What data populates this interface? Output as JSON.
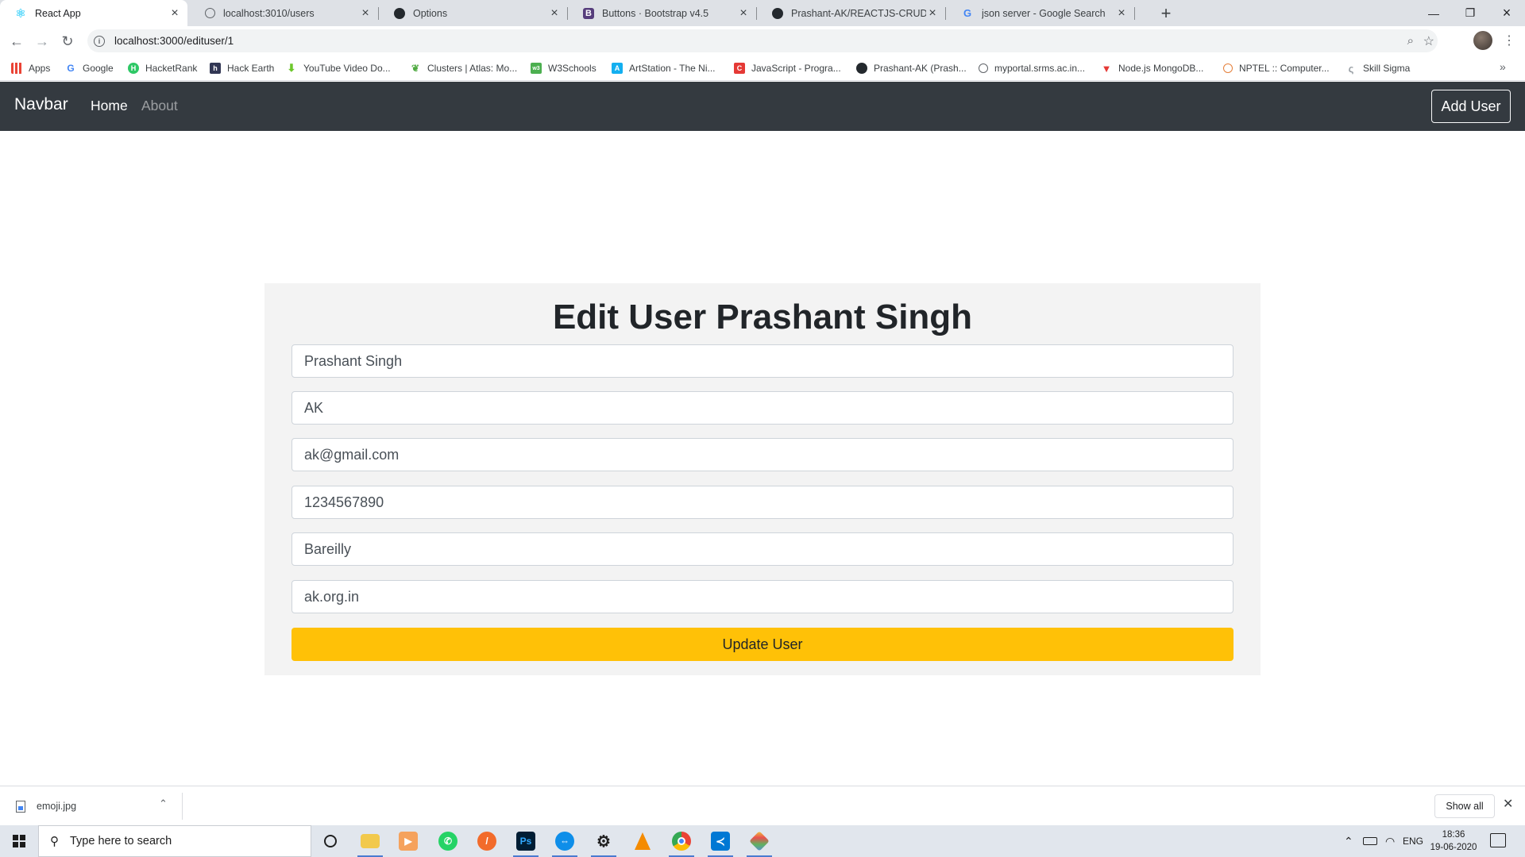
{
  "browser": {
    "tabs": [
      {
        "title": "React App",
        "icon": "react-icon",
        "active": true
      },
      {
        "title": "localhost:3010/users",
        "icon": "globe-icon",
        "active": false
      },
      {
        "title": "Options",
        "icon": "github-icon",
        "active": false
      },
      {
        "title": "Buttons · Bootstrap v4.5",
        "icon": "bootstrap-icon",
        "active": false
      },
      {
        "title": "Prashant-AK/REACTJS-CRUD-: Cr",
        "icon": "github-icon",
        "active": false
      },
      {
        "title": "json server - Google Search",
        "icon": "google-icon",
        "active": false
      }
    ],
    "url": "localhost:3000/edituser/1",
    "bookmarks": [
      {
        "label": "Apps",
        "icon": "apps-grid-icon"
      },
      {
        "label": "Google",
        "icon": "google-icon"
      },
      {
        "label": "HacketRank",
        "icon": "hackerrank-icon"
      },
      {
        "label": "Hack Earth",
        "icon": "hackerearth-icon"
      },
      {
        "label": "YouTube Video Do...",
        "icon": "download-arrow-icon"
      },
      {
        "label": "Clusters | Atlas: Mo...",
        "icon": "mongodb-leaf-icon"
      },
      {
        "label": "W3Schools",
        "icon": "w3schools-icon"
      },
      {
        "label": "ArtStation - The Ni...",
        "icon": "artstation-icon"
      },
      {
        "label": "JavaScript - Progra...",
        "icon": "c-icon"
      },
      {
        "label": "Prashant-AK (Prash...",
        "icon": "github-icon"
      },
      {
        "label": "myportal.srms.ac.in...",
        "icon": "portal-icon"
      },
      {
        "label": "Node.js MongoDB...",
        "icon": "v-icon"
      },
      {
        "label": "NPTEL :: Computer...",
        "icon": "nptel-icon"
      },
      {
        "label": "Skill Sigma",
        "icon": "skill-sigma-icon"
      }
    ]
  },
  "app": {
    "brand": "Navbar",
    "nav": {
      "home": "Home",
      "about": "About"
    },
    "add_user": "Add User",
    "form": {
      "title": "Edit User Prashant Singh",
      "fields": {
        "name": "Prashant Singh",
        "username": "AK",
        "email": "ak@gmail.com",
        "phone": "1234567890",
        "city": "Bareilly",
        "website": "ak.org.in"
      },
      "submit": "Update User"
    },
    "colors": {
      "navbar": "#343a40",
      "warning": "#ffc107",
      "card": "#f3f3f3"
    }
  },
  "downloads": {
    "file": "emoji.jpg",
    "show_all": "Show all"
  },
  "taskbar": {
    "search_placeholder": "Type here to search",
    "language": "ENG",
    "time": "18:36",
    "date": "19-06-2020"
  }
}
